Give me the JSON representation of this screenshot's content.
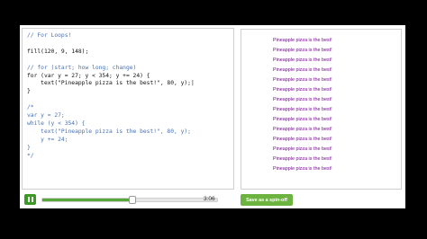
{
  "editor": {
    "lines": [
      {
        "text": "// For Loops!",
        "type": "comment"
      },
      {
        "text": "",
        "type": "plain"
      },
      {
        "text": "fill(120, 9, 148);",
        "type": "plain"
      },
      {
        "text": "",
        "type": "plain"
      },
      {
        "text": "// for (start; how long; change)",
        "type": "comment"
      },
      {
        "text": "for (var y = 27; y < 354; y += 24) {",
        "type": "plain"
      },
      {
        "text": "    text(\"Pineapple pizza is the best!\", 80, y);|",
        "type": "plain"
      },
      {
        "text": "}",
        "type": "plain"
      },
      {
        "text": "",
        "type": "plain"
      },
      {
        "text": "/*",
        "type": "comment"
      },
      {
        "text": "var y = 27;",
        "type": "comment"
      },
      {
        "text": "while (y < 354) {",
        "type": "comment"
      },
      {
        "text": "    text(\"Pineapple pizza is the best!\", 80, y);",
        "type": "comment"
      },
      {
        "text": "    y += 24;",
        "type": "comment"
      },
      {
        "text": "}",
        "type": "comment"
      },
      {
        "text": "*/",
        "type": "comment"
      }
    ]
  },
  "canvas": {
    "text": "Pineapple pizza is the best!",
    "repeat_count": 14,
    "text_color": "#780994"
  },
  "player": {
    "time": "3:06",
    "progress": 0.56
  },
  "spinoff_button": {
    "label": "Save as a spin-off"
  },
  "colors": {
    "accent": "#6cb33f",
    "play_button": "#3a9a24",
    "comment": "#4a72b0"
  }
}
